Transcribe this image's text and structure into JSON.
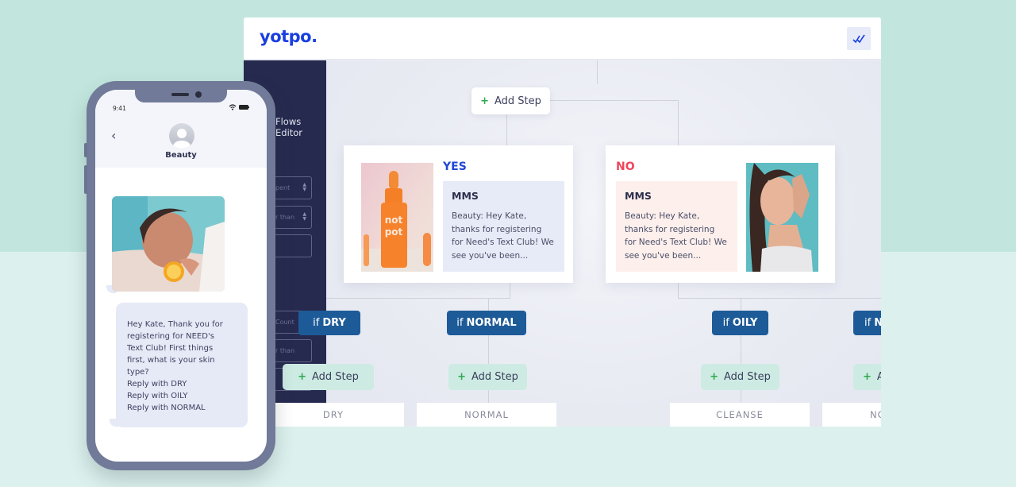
{
  "app": {
    "logo": "yotpo.",
    "header_button_icon": "double-check-icon",
    "sidebar": {
      "title_line1": "Flows",
      "title_line2": "Editor",
      "fields": [
        {
          "text": "pent"
        },
        {
          "text": "r than"
        },
        {
          "text": ""
        },
        {
          "text": "Count"
        },
        {
          "text": "r than"
        },
        {
          "text": ""
        }
      ]
    },
    "flow": {
      "top_add_step": {
        "icon": "plus-icon",
        "label": "Add Step"
      },
      "branches": [
        {
          "label": "YES",
          "label_color": "#1f47d6",
          "message_type": "MMS",
          "message_text": "Beauty: Hey Kate, thanks for registering for Need's Text Club! We see you've been...",
          "message_bg": "#e7ebf7",
          "image": "orange-serum-bottle-photo"
        },
        {
          "label": "NO",
          "label_color": "#f0455a",
          "message_type": "MMS",
          "message_text": "Beauty: Hey Kate, thanks for registering for Need's Text Club! We see you've been...",
          "message_bg": "#fcefec",
          "image": "woman-skincare-photo"
        }
      ],
      "conditions": [
        {
          "prefix": "if",
          "value": "DRY"
        },
        {
          "prefix": "if",
          "value": "NORMAL"
        },
        {
          "prefix": "if",
          "value": "OILY"
        },
        {
          "prefix": "if",
          "value": "NORMAL"
        }
      ],
      "add_steps": [
        {
          "label": "Add Step"
        },
        {
          "label": "Add Step"
        },
        {
          "label": "Add Step"
        },
        {
          "label": "Add Step"
        }
      ],
      "tags": [
        "DRY",
        "NORMAL",
        "CLEANSE",
        "NORMAL"
      ]
    }
  },
  "phone": {
    "time": "9:41",
    "contact_name": "Beauty",
    "back_icon": "chevron-left-icon",
    "image": "woman-with-orange-photo",
    "message": {
      "lines": [
        "Hey Kate, Thank you for",
        "registering for NEED's",
        "Text Club! First things",
        "first, what is your skin",
        "type?",
        "Reply with DRY",
        "Reply with OILY",
        "Reply with NORMAL"
      ]
    }
  }
}
